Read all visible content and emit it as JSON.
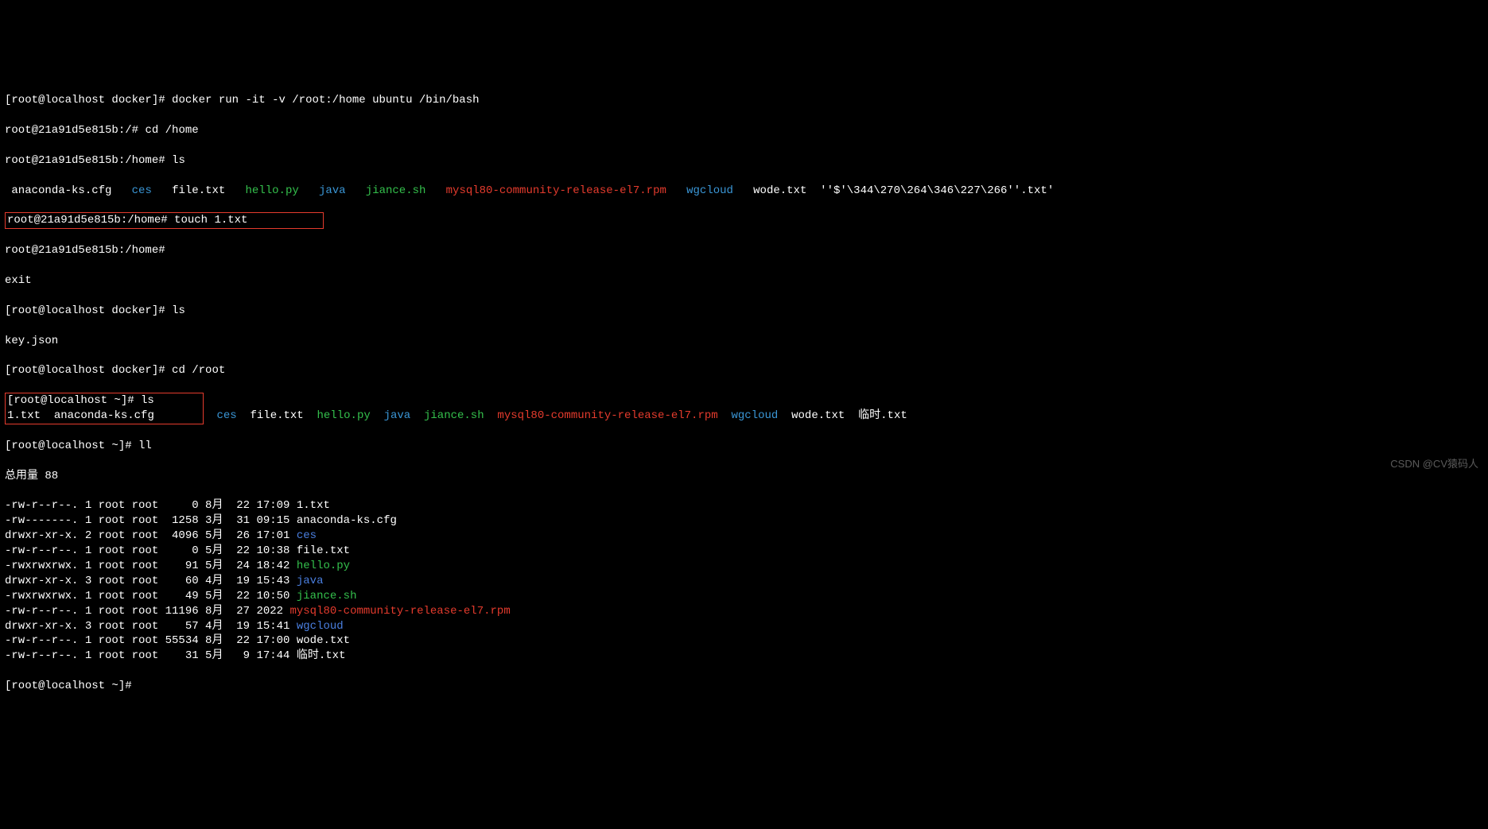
{
  "lines": {
    "l1": {
      "prompt": "[root@localhost docker]# ",
      "cmd": "docker run -it -v /root:/home ubuntu /bin/bash"
    },
    "l2": {
      "prompt": "root@21a91d5e815b:/# ",
      "cmd": "cd /home"
    },
    "l3": {
      "prompt": "root@21a91d5e815b:/home# ",
      "cmd": "ls"
    },
    "l4_items": {
      "pad": " ",
      "anaconda": "anaconda-ks.cfg",
      "ces": "ces",
      "file": "file.txt",
      "hello": "hello.py",
      "java": "java",
      "jiance": "jiance.sh",
      "mysql": "mysql80-community-release-el7.rpm",
      "wgcloud": "wgcloud",
      "wode": "wode.txt",
      "weird": "''$'\\344\\270\\264\\346\\227\\266''.txt'"
    },
    "l5_box": {
      "prompt": "root@21a91d5e815b:/home# ",
      "cmd": "touch 1.txt",
      "after": "           "
    },
    "l6": {
      "prompt": "root@21a91d5e815b:/home# "
    },
    "l7": "exit",
    "l8": {
      "prompt": "[root@localhost docker]# ",
      "cmd": "ls"
    },
    "l9": "key.json",
    "l10": {
      "prompt": "[root@localhost docker]# ",
      "cmd": "cd /root"
    },
    "l11_box": {
      "prompt": "[root@localhost ~]# ",
      "cmd": "ls"
    },
    "l12_box_items": {
      "txt1": "1.txt",
      "anaconda": "anaconda-ks.cfg"
    },
    "l12_rest": {
      "ces": "ces",
      "file": "file.txt",
      "hello": "hello.py",
      "java": "java",
      "jiance": "jiance.sh",
      "mysql": "mysql80-community-release-el7.rpm",
      "wgcloud": "wgcloud",
      "wode": "wode.txt",
      "linshi": "临时.txt"
    },
    "l13": {
      "prompt": "[root@localhost ~]# ",
      "cmd": "ll"
    },
    "l14": "总用量 88",
    "ll": [
      {
        "meta": "-rw-r--r--. 1 root root     0 8月  22 17:09 ",
        "name": "1.txt",
        "cls": ""
      },
      {
        "meta": "-rw-------. 1 root root  1258 3月  31 09:15 ",
        "name": "anaconda-ks.cfg",
        "cls": ""
      },
      {
        "meta": "drwxr-xr-x. 2 root root  4096 5月  26 17:01 ",
        "name": "ces",
        "cls": "blue"
      },
      {
        "meta": "-rw-r--r--. 1 root root     0 5月  22 10:38 ",
        "name": "file.txt",
        "cls": ""
      },
      {
        "meta": "-rwxrwxrwx. 1 root root    91 5月  24 18:42 ",
        "name": "hello.py",
        "cls": "green"
      },
      {
        "meta": "drwxr-xr-x. 3 root root    60 4月  19 15:43 ",
        "name": "java",
        "cls": "blue"
      },
      {
        "meta": "-rwxrwxrwx. 1 root root    49 5月  22 10:50 ",
        "name": "jiance.sh",
        "cls": "green"
      },
      {
        "meta": "-rw-r--r--. 1 root root 11196 8月  27 2022 ",
        "name": "mysql80-community-release-el7.rpm",
        "cls": "red"
      },
      {
        "meta": "drwxr-xr-x. 3 root root    57 4月  19 15:41 ",
        "name": "wgcloud",
        "cls": "blue"
      },
      {
        "meta": "-rw-r--r--. 1 root root 55534 8月  22 17:00 ",
        "name": "wode.txt",
        "cls": ""
      },
      {
        "meta": "-rw-r--r--. 1 root root    31 5月   9 17:44 ",
        "name": "临时.txt",
        "cls": ""
      }
    ],
    "l_last": {
      "prompt": "[root@localhost ~]# "
    }
  },
  "watermark": "CSDN @CV猿码人"
}
